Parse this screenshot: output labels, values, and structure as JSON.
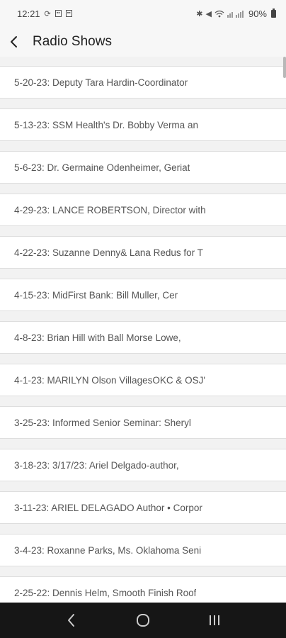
{
  "status_bar": {
    "time": "12:21",
    "battery": "90%"
  },
  "app_bar": {
    "title": "Radio Shows",
    "back_icon": "chevron-left-icon"
  },
  "shows": [
    {
      "label": "5-20-23: Deputy Tara Hardin-Coordinator"
    },
    {
      "label": "5-13-23: SSM Health's Dr. Bobby Verma an"
    },
    {
      "label": "5-6-23: Dr. Germaine Odenheimer, Geriat"
    },
    {
      "label": "4-29-23: LANCE ROBERTSON, Director with"
    },
    {
      "label": "4-22-23: Suzanne Denny& Lana Redus for T"
    },
    {
      "label": "4-15-23: MidFirst Bank: Bill Muller, Cer"
    },
    {
      "label": "4-8-23: Brian Hill with Ball Morse Lowe,"
    },
    {
      "label": "4-1-23: MARILYN Olson VillagesOKC & OSJ'"
    },
    {
      "label": "3-25-23: Informed Senior Seminar: Sheryl"
    },
    {
      "label": "3-18-23: 3/17/23: Ariel Delgado-author,"
    },
    {
      "label": "3-11-23: ARIEL DELAGADO Author • Corpor"
    },
    {
      "label": "3-4-23: Roxanne Parks, Ms. Oklahoma Seni"
    },
    {
      "label": "2-25-22: Dennis Helm, Smooth Finish Roof"
    }
  ],
  "nav_bar": {
    "back": "nav-back-icon",
    "home": "nav-home-icon",
    "recents": "nav-recents-icon"
  }
}
